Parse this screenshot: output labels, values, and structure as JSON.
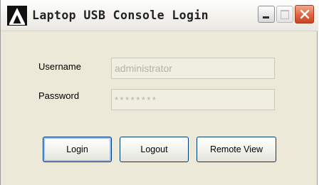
{
  "window": {
    "title": "Laptop USB Console Login"
  },
  "controls": {
    "minimize_icon": "minimize-icon",
    "maximize_icon": "maximize-icon",
    "close_icon": "close-icon"
  },
  "form": {
    "username_label": "Username",
    "username_value": "administrator",
    "password_label": "Password",
    "password_value": "********"
  },
  "buttons": {
    "login": "Login",
    "logout": "Logout",
    "remote_view": "Remote View"
  },
  "colors": {
    "window_bg": "#ece9d8",
    "field_bg": "#f0eee1",
    "close_button": "#e06540",
    "default_button_focus": "#9db8e9"
  }
}
